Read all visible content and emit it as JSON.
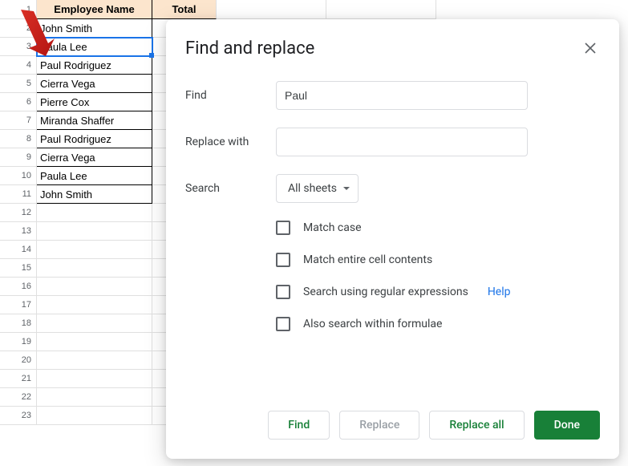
{
  "spreadsheet": {
    "columns": [
      {
        "id": "A",
        "label": "Employee Name",
        "width": 144
      },
      {
        "id": "B",
        "label": "Total",
        "width": 80
      }
    ],
    "rows": [
      {
        "num": 1
      },
      {
        "num": 2,
        "A": "John Smith"
      },
      {
        "num": 3,
        "A": "Paula Lee",
        "selected": true
      },
      {
        "num": 4,
        "A": "Paul Rodriguez"
      },
      {
        "num": 5,
        "A": "Cierra Vega"
      },
      {
        "num": 6,
        "A": "Pierre Cox"
      },
      {
        "num": 7,
        "A": "Miranda Shaffer"
      },
      {
        "num": 8,
        "A": "Paul Rodriguez"
      },
      {
        "num": 9,
        "A": "Cierra Vega"
      },
      {
        "num": 10,
        "A": "Paula Lee"
      },
      {
        "num": 11,
        "A": "John Smith"
      },
      {
        "num": 12
      },
      {
        "num": 13
      },
      {
        "num": 14
      },
      {
        "num": 15
      },
      {
        "num": 16
      },
      {
        "num": 17
      },
      {
        "num": 18
      },
      {
        "num": 19
      },
      {
        "num": 20
      },
      {
        "num": 21
      },
      {
        "num": 22
      },
      {
        "num": 23
      }
    ]
  },
  "dialog": {
    "title": "Find and replace",
    "find_label": "Find",
    "find_value": "Paul",
    "replace_label": "Replace with",
    "replace_value": "",
    "search_label": "Search",
    "search_scope": "All sheets",
    "checkboxes": {
      "match_case": "Match case",
      "match_entire": "Match entire cell contents",
      "regex": "Search using regular expressions",
      "formulae": "Also search within formulae"
    },
    "help_link": "Help",
    "buttons": {
      "find": "Find",
      "replace": "Replace",
      "replace_all": "Replace all",
      "done": "Done"
    }
  }
}
